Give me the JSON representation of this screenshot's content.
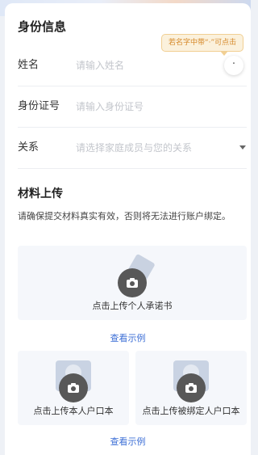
{
  "identity": {
    "title": "身份信息",
    "tooltip": "若名字中带“·”可点击",
    "name_label": "姓名",
    "name_placeholder": "请输入姓名",
    "dot_button": "·",
    "id_label": "身份证号",
    "id_placeholder": "请输入身份证号",
    "relation_label": "关系",
    "relation_placeholder": "请选择家庭成员与您的关系"
  },
  "materials": {
    "title": "材料上传",
    "notice": "请确保提交材料真实有效，否则将无法进行账户绑定。",
    "commitment_label": "点击上传个人承诺书",
    "example_link_1": "查看示例",
    "own_household_label": "点击上传本人户口本",
    "bound_household_label": "点击上传被绑定人户口本",
    "example_link_2": "查看示例"
  },
  "colors": {
    "accent": "#3d6fd6",
    "tooltip_bg": "#fbf1dc",
    "tooltip_text": "#d6892a",
    "camera": "#585858"
  },
  "icons": {
    "camera": "camera-icon",
    "dropdown": "caret-down-icon"
  }
}
